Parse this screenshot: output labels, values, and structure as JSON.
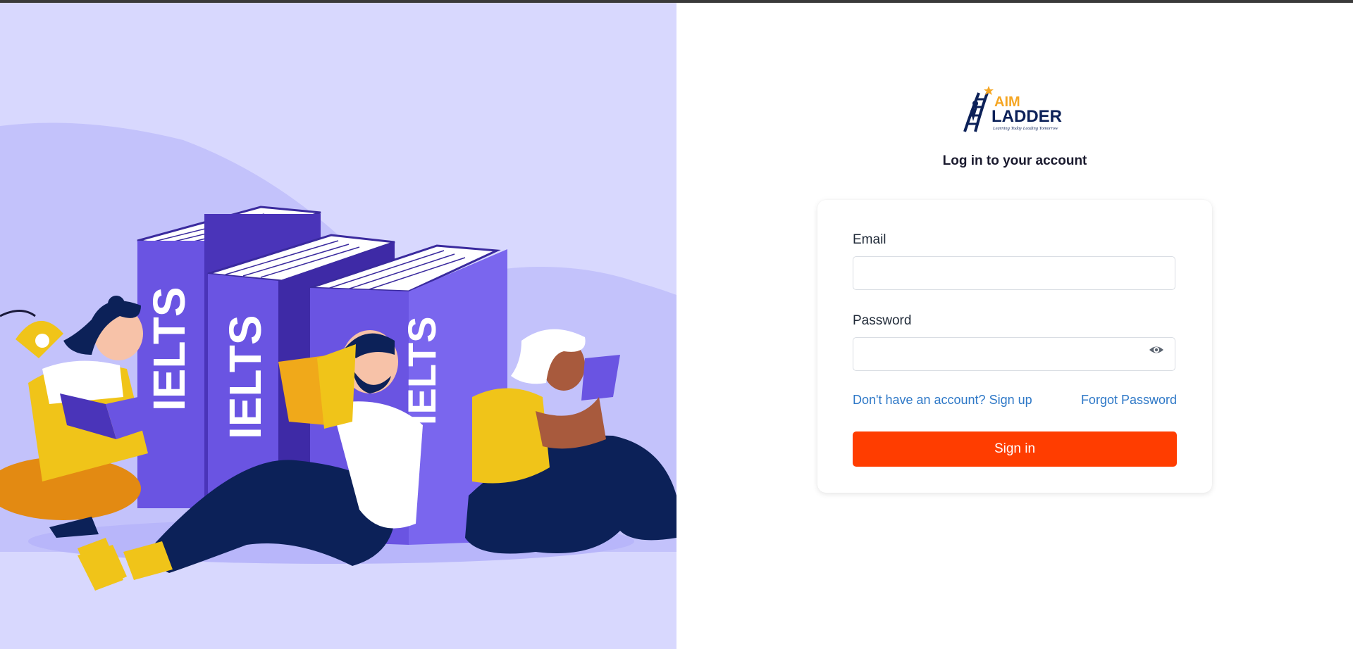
{
  "illustration": {
    "book_spine_text": "IELTS",
    "colors": {
      "background": "#d8d8fe",
      "blob": "#c3c2fb",
      "book": "#6a54e2",
      "accent_yellow": "#f0c419",
      "navy": "#0c2158"
    }
  },
  "brand": {
    "logo_text_top": "AIM",
    "logo_text_main": "LADDER",
    "tagline": "Learning Today Leading Tomorrow"
  },
  "login": {
    "heading": "Log in to your account",
    "email_label": "Email",
    "email_value": "",
    "password_label": "Password",
    "password_value": "",
    "password_toggle_icon": "eye-icon",
    "signup_link": "Don't have an account? Sign up",
    "forgot_link": "Forgot Password",
    "submit_label": "Sign in"
  },
  "colors": {
    "primary_button": "#ff3d00",
    "link": "#2e78c7",
    "heading_text": "#1a1a2e"
  }
}
